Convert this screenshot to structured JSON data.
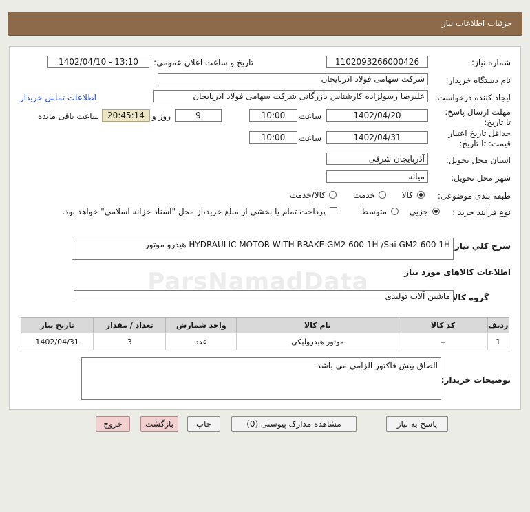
{
  "header": {
    "title": "جزئیات اطلاعات نیاز"
  },
  "fields": {
    "need_number_label": "شماره نیاز:",
    "need_number": "1102093266000426",
    "announce_label": "تاریخ و ساعت اعلان عمومی:",
    "announce_value": "1402/04/10 - 13:10",
    "buyer_org_label": "نام دستگاه خریدار:",
    "buyer_org": "شرکت سهامی فولاد اذربایجان",
    "requester_label": "ایجاد کننده درخواست:",
    "requester": "علیرضا رسولزاده کارشناس بازرگانی شرکت سهامی فولاد اذربایجان",
    "contact_link": "اطلاعات تماس خریدار",
    "reply_deadline_label": "مهلت ارسال پاسخ: تا تاریخ:",
    "reply_date": "1402/04/20",
    "time_label": "ساعت",
    "reply_time": "10:00",
    "days_value": "9",
    "days_label": "روز و",
    "remaining_time": "20:45:14",
    "remaining_label": "ساعت باقی مانده",
    "validity_label": "حداقل تاریخ اعتبار قیمت: تا تاریخ:",
    "validity_date": "1402/04/31",
    "validity_time": "10:00",
    "province_label": "استان محل تحویل:",
    "province": "آذربایجان شرقی",
    "city_label": "شهر محل تحویل:",
    "city": "میانه",
    "category_label": "طبقه بندی موضوعی:",
    "category_options": [
      "کالا",
      "خدمت",
      "کالا/خدمت"
    ],
    "process_label": "نوع فرآیند خرید :",
    "process_options": [
      "جزیی",
      "متوسط"
    ],
    "payment_note": "پرداخت تمام یا بخشی از مبلغ خرید،از محل \"اسناد خزانه اسلامی\" خواهد بود."
  },
  "description": {
    "label": "شرح کلي نياز:",
    "text": "HYDRAULIC MOTOR WITH BRAKE  GM2 600 1H /Sai GM2 600 1H هیدرو موتور"
  },
  "goods_section": {
    "title": "اطلاعات کالاهای مورد نیاز",
    "group_label": "گروه کالا:",
    "group_value": "ماشین آلات تولیدی"
  },
  "table": {
    "headers": [
      "ردیف",
      "کد کالا",
      "نام کالا",
      "واحد شمارش",
      "تعداد / مقدار",
      "تاریخ نیاز"
    ],
    "rows": [
      [
        "1",
        "--",
        "موتور هیدرولیکی",
        "عدد",
        "3",
        "1402/04/31"
      ]
    ]
  },
  "buyer_notes": {
    "label": "توضیحات خریدار:",
    "text": "الصاق پیش فاکتور الزامی می باشد"
  },
  "buttons": {
    "reply": "پاسخ به نیاز",
    "view_docs": "مشاهده مدارک پیوستی (0)",
    "print": "چاپ",
    "back": "بازگشت",
    "exit": "خروج"
  }
}
